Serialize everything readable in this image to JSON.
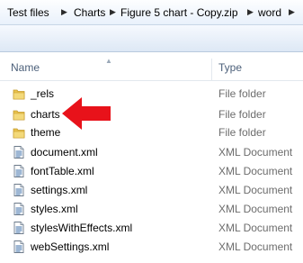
{
  "breadcrumb": {
    "items": [
      "Test files",
      "Charts",
      "Figure 5 chart - Copy.zip",
      "word"
    ]
  },
  "columns": {
    "name": "Name",
    "type": "Type"
  },
  "files": [
    {
      "name": "_rels",
      "type": "File folder",
      "icon": "folder-icon"
    },
    {
      "name": "charts",
      "type": "File folder",
      "icon": "folder-icon"
    },
    {
      "name": "theme",
      "type": "File folder",
      "icon": "folder-icon"
    },
    {
      "name": "document.xml",
      "type": "XML Document",
      "icon": "xml-document-icon"
    },
    {
      "name": "fontTable.xml",
      "type": "XML Document",
      "icon": "xml-document-icon"
    },
    {
      "name": "settings.xml",
      "type": "XML Document",
      "icon": "xml-document-icon"
    },
    {
      "name": "styles.xml",
      "type": "XML Document",
      "icon": "xml-document-icon"
    },
    {
      "name": "stylesWithEffects.xml",
      "type": "XML Document",
      "icon": "xml-document-icon"
    },
    {
      "name": "webSettings.xml",
      "type": "XML Document",
      "icon": "xml-document-icon"
    }
  ],
  "annotation": {
    "icon": "red-arrow-icon",
    "color": "#e8121a"
  },
  "colors": {
    "folder": "#e8c24e",
    "header_text": "#4c607a",
    "type_text": "#6d6d6d"
  }
}
